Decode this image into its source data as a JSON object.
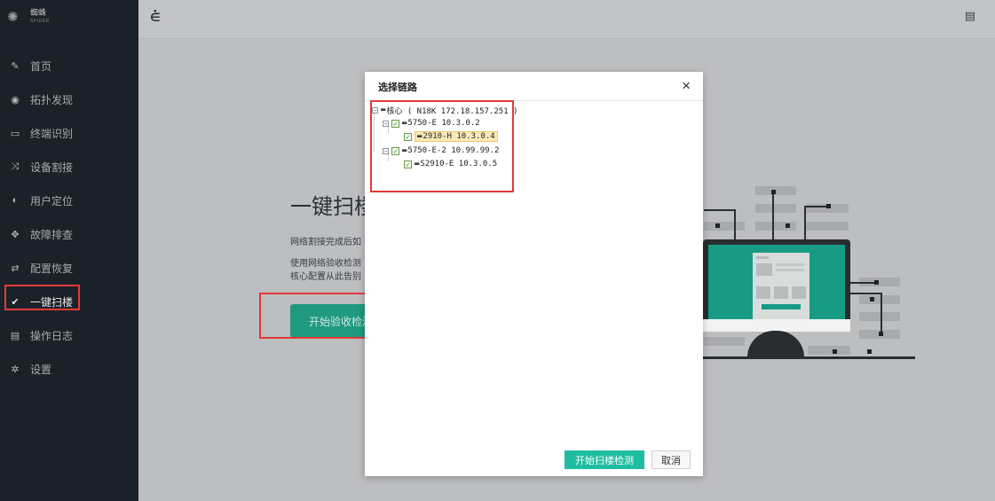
{
  "app": {
    "logo_name": "蜘蛛",
    "logo_sub": "SPIDER"
  },
  "sidebar": {
    "items": [
      {
        "label": "首页",
        "icon": "wrench-icon"
      },
      {
        "label": "拓扑发现",
        "icon": "eye-icon"
      },
      {
        "label": "终端识别",
        "icon": "monitor-icon"
      },
      {
        "label": "设备割接",
        "icon": "shuffle-icon"
      },
      {
        "label": "用户定位",
        "icon": "eye-slash-icon"
      },
      {
        "label": "故障排查",
        "icon": "move-icon"
      },
      {
        "label": "配置恢复",
        "icon": "retweet-icon"
      },
      {
        "label": "一键扫楼",
        "icon": "check-icon",
        "active": true
      },
      {
        "label": "操作日志",
        "icon": "list-icon"
      },
      {
        "label": "设置",
        "icon": "gear-icon"
      }
    ]
  },
  "main": {
    "headline": "一键扫楼",
    "paragraph1": "网络割接完成后如",
    "paragraph2_line1": "使用网络验收检测",
    "paragraph2_line2": "核心配置从此告别",
    "start_button": "开始验收检测"
  },
  "modal": {
    "title": "选择链路",
    "close": "×",
    "tree": {
      "root": "核心 ( N18K 172.18.157.251 )",
      "n1": "5750-E 10.3.0.2",
      "n1a": "2910-H 10.3.0.4",
      "n2": "5750-E-2 10.99.99.2",
      "n2a": "S2910-E 10.3.0.5"
    },
    "confirm_button": "开始扫楼检测",
    "cancel_button": "取消"
  },
  "colors": {
    "accent": "#1fbda0",
    "highlight": "#e23a37",
    "sidebar": "#1b2128"
  }
}
